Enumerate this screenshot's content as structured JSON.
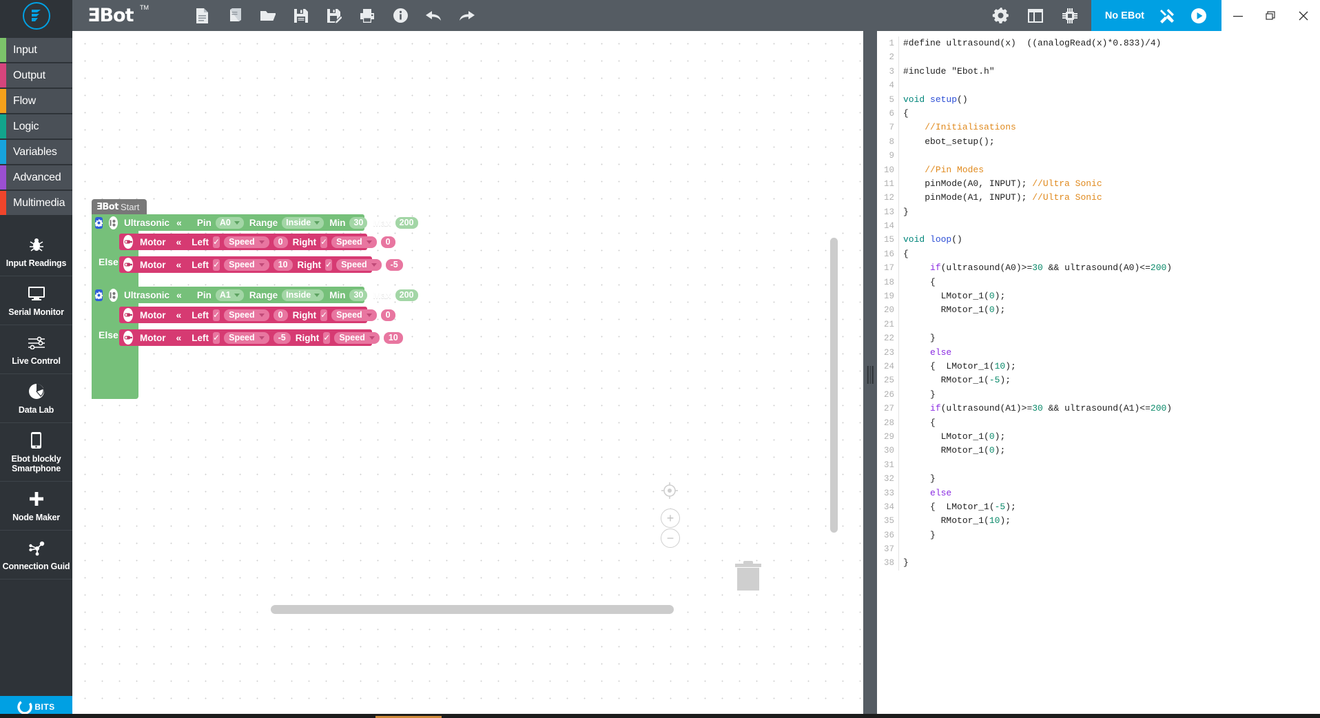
{
  "app": {
    "brand": "ƎBot",
    "tm": "TM"
  },
  "toolbar": {
    "items": [
      {
        "name": "new-file-icon",
        "label": "New"
      },
      {
        "name": "examples-book-icon",
        "label": "Examples"
      },
      {
        "name": "open-folder-icon",
        "label": "Open"
      },
      {
        "name": "save-icon",
        "label": "Save"
      },
      {
        "name": "save-as-icon",
        "label": "Save As"
      },
      {
        "name": "print-icon",
        "label": "Print"
      },
      {
        "name": "info-icon",
        "label": "Info"
      },
      {
        "name": "undo-icon",
        "label": "Undo"
      },
      {
        "name": "redo-icon",
        "label": "Redo"
      }
    ],
    "right": [
      {
        "name": "settings-gear-icon",
        "label": "Settings"
      },
      {
        "name": "layout-panel-icon",
        "label": "Layout"
      },
      {
        "name": "chip-icon",
        "label": "Board"
      }
    ],
    "connection_label": "No EBot",
    "connect-tool-label": "Tools",
    "run-label": "Run",
    "window": {
      "minimize": "—",
      "maximize": "❐",
      "close": "✕"
    }
  },
  "sidebar": {
    "categories": [
      {
        "label": "Input",
        "color": "#7dc46a"
      },
      {
        "label": "Output",
        "color": "#d6457c"
      },
      {
        "label": "Flow",
        "color": "#f5a11b"
      },
      {
        "label": "Logic",
        "color": "#12a58c"
      },
      {
        "label": "Variables",
        "color": "#17a3dd"
      },
      {
        "label": "Advanced",
        "color": "#9b4fd1"
      },
      {
        "label": "Multimedia",
        "color": "#f0452b"
      }
    ],
    "tools": [
      {
        "label": "Input Readings",
        "icon": "bug-icon"
      },
      {
        "label": "Serial Monitor",
        "icon": "monitor-icon"
      },
      {
        "label": "Live Control",
        "icon": "sliders-icon"
      },
      {
        "label": "Data Lab",
        "icon": "pie-chart-icon"
      },
      {
        "label": "Ebot blockly Smartphone",
        "icon": "smartphone-icon"
      },
      {
        "label": "Node Maker",
        "icon": "plus-icon"
      },
      {
        "label": "Connection Guid",
        "icon": "network-icon"
      }
    ],
    "footer_label": "BITS",
    "accent": "#00a0e3"
  },
  "workspace": {
    "hat": {
      "brand": "ƎBot",
      "word": "Start"
    },
    "groups": [
      {
        "condition": {
          "title": "Ultrasonic",
          "chev": "«",
          "fields": [
            {
              "label": "Pin",
              "value": "A0",
              "dropdown": true
            },
            {
              "label": "Range",
              "value": "Inside",
              "dropdown": true
            },
            {
              "label": "Min",
              "value": "30",
              "dropdown": false
            },
            {
              "label": "Max",
              "value": "200",
              "dropdown": false
            }
          ]
        },
        "do": {
          "title": "Motor",
          "chev": "«",
          "left_label": "Left",
          "left_check": "✓",
          "left_mode": "Speed",
          "left_value": "0",
          "right_label": "Right",
          "right_check": "✓",
          "right_mode": "Speed",
          "right_value": "0"
        },
        "else_label": "Else",
        "else_do": {
          "title": "Motor",
          "chev": "«",
          "left_label": "Left",
          "left_check": "✓",
          "left_mode": "Speed",
          "left_value": "10",
          "right_label": "Right",
          "right_check": "✓",
          "right_mode": "Speed",
          "right_value": "-5"
        }
      },
      {
        "condition": {
          "title": "Ultrasonic",
          "chev": "«",
          "fields": [
            {
              "label": "Pin",
              "value": "A1",
              "dropdown": true
            },
            {
              "label": "Range",
              "value": "Inside",
              "dropdown": true
            },
            {
              "label": "Min",
              "value": "30",
              "dropdown": false
            },
            {
              "label": "Max",
              "value": "200",
              "dropdown": false
            }
          ]
        },
        "do": {
          "title": "Motor",
          "chev": "«",
          "left_label": "Left",
          "left_check": "✓",
          "left_mode": "Speed",
          "left_value": "0",
          "right_label": "Right",
          "right_check": "✓",
          "right_mode": "Speed",
          "right_value": "0"
        },
        "else_label": "Else",
        "else_do": {
          "title": "Motor",
          "chev": "«",
          "left_label": "Left",
          "left_check": "✓",
          "left_mode": "Speed",
          "left_value": "-5",
          "right_label": "Right",
          "right_check": "✓",
          "right_mode": "Speed",
          "right_value": "10"
        }
      }
    ],
    "controls": {
      "center_icon": "crosshair-icon",
      "zoom_in": "+",
      "zoom_out": "−",
      "trash_icon": "trash-icon"
    }
  },
  "code": {
    "lines": [
      {
        "n": "1",
        "html": "#define ultrasound(x)  ((analogRead(x)*0.833)/4)"
      },
      {
        "n": "2",
        "html": ""
      },
      {
        "n": "3",
        "html": "#include \"Ebot.h\""
      },
      {
        "n": "4",
        "html": ""
      },
      {
        "n": "5",
        "html": "<span class='kw-green'>void</span> <span class='kw-blue'>setup</span>()"
      },
      {
        "n": "6",
        "html": "{"
      },
      {
        "n": "7",
        "html": "    <span class='cmt'>//Initialisations</span>"
      },
      {
        "n": "8",
        "html": "    ebot_setup();"
      },
      {
        "n": "9",
        "html": ""
      },
      {
        "n": "10",
        "html": "    <span class='cmt'>//Pin Modes</span>"
      },
      {
        "n": "11",
        "html": "    pinMode(A0, INPUT); <span class='cmt'>//Ultra Sonic</span>"
      },
      {
        "n": "12",
        "html": "    pinMode(A1, INPUT); <span class='cmt'>//Ultra Sonic</span>"
      },
      {
        "n": "13",
        "html": "}"
      },
      {
        "n": "14",
        "html": ""
      },
      {
        "n": "15",
        "html": "<span class='kw-green'>void</span> <span class='kw-blue'>loop</span>()"
      },
      {
        "n": "16",
        "html": "{"
      },
      {
        "n": "17",
        "html": "     <span class='kw-purple'>if</span>(ultrasound(A0)&gt;=<span class='num'>30</span> &amp;&amp; ultrasound(A0)&lt;=<span class='num'>200</span>)"
      },
      {
        "n": "18",
        "html": "     {"
      },
      {
        "n": "19",
        "html": "       LMotor_1(<span class='num'>0</span>);"
      },
      {
        "n": "20",
        "html": "       RMotor_1(<span class='num'>0</span>);"
      },
      {
        "n": "21",
        "html": ""
      },
      {
        "n": "22",
        "html": "     }"
      },
      {
        "n": "23",
        "html": "     <span class='kw-purple'>else</span>"
      },
      {
        "n": "24",
        "html": "     {  LMotor_1(<span class='num'>10</span>);"
      },
      {
        "n": "25",
        "html": "       RMotor_1(<span class='num'>-5</span>);"
      },
      {
        "n": "26",
        "html": "     }"
      },
      {
        "n": "27",
        "html": "     <span class='kw-purple'>if</span>(ultrasound(A1)&gt;=<span class='num'>30</span> &amp;&amp; ultrasound(A1)&lt;=<span class='num'>200</span>)"
      },
      {
        "n": "28",
        "html": "     {"
      },
      {
        "n": "29",
        "html": "       LMotor_1(<span class='num'>0</span>);"
      },
      {
        "n": "30",
        "html": "       RMotor_1(<span class='num'>0</span>);"
      },
      {
        "n": "31",
        "html": ""
      },
      {
        "n": "32",
        "html": "     }"
      },
      {
        "n": "33",
        "html": "     <span class='kw-purple'>else</span>"
      },
      {
        "n": "34",
        "html": "     {  LMotor_1(<span class='num'>-5</span>);"
      },
      {
        "n": "35",
        "html": "       RMotor_1(<span class='num'>10</span>);"
      },
      {
        "n": "36",
        "html": "     }"
      },
      {
        "n": "37",
        "html": ""
      },
      {
        "n": "38",
        "html": "}"
      }
    ]
  }
}
